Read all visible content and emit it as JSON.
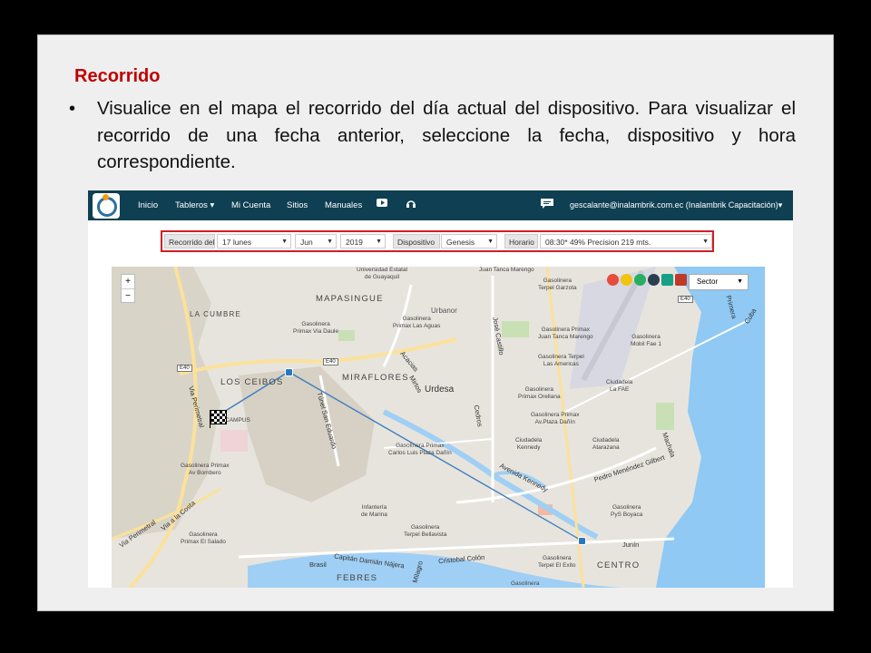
{
  "slide": {
    "title": "Recorrido",
    "bullet": "Visualice en el mapa el recorrido del día actual del dispositivo. Para visualizar el recorrido de una fecha anterior, seleccione la fecha, dispositivo y hora correspondiente."
  },
  "navbar": {
    "items": [
      "Inicio",
      "Tableros ▾",
      "Mi Cuenta",
      "Sitios",
      "Manuales"
    ],
    "icons": [
      "youtube-icon",
      "headset-icon",
      "chat-icon"
    ],
    "user": "gescalante@inalambrik.com.ec (Inalambrik Capacitación)▾"
  },
  "filters": {
    "recorrido_label": "Recorrido del",
    "day": "17 lunes",
    "month": "Jun",
    "year": "2019",
    "dispositivo_label": "Dispositivo",
    "device": "Genesis",
    "horario_label": "Horario",
    "time": "08:30* 49% Precision 219 mts."
  },
  "map": {
    "zoom_in": "+",
    "zoom_out": "−",
    "sector": "Sector",
    "labels": {
      "mapasingue": "MAPASINGUE",
      "la_cumbre": "LA CUMBRE",
      "los_ceibos": "LOS CEIBOS",
      "miraflores": "MIRAFLORES",
      "urdesa": "Urdesa",
      "urbanor": "Urbanor",
      "centro": "CENTRO",
      "febres": "FEBRES",
      "kennedy": "Ciudadela\nKennedy",
      "atarazana": "Ciudadela\nAtarazana",
      "la_fae": "Ciudadela\nLa FAE",
      "infanteria": "Infantería\nde Marina",
      "universidad": "Universidad Estatal\nde Guayaquil",
      "campus": "CAMPUS",
      "pos_1": "Gasolinera\nPrimax Via Daule",
      "pos_2": "Gasolinera\nPrimax Las Aguas",
      "pos_3": "Gasolinera Primax\nJuan Tanca Marengo",
      "pos_4": "Gasolinera\nMobil Fae 1",
      "pos_5": "Gasolinera Terpel\nLas Americas",
      "pos_6": "Gasolinera\nPrimax Orellana",
      "pos_7": "Gasolinera Primax\nAv.Plaza Dañín",
      "pos_8": "Gasolinera Primax\nCarlos Luis Plaza Dañín",
      "pos_9": "Gasolinera Primax\nAv Bombero",
      "pos_10": "Gasolinera\nPrimax El Salado",
      "pos_11": "Gasolinera\nTerpel Bellavista",
      "pos_12": "Gasolinera\nTerpel El Exito",
      "pos_13": "Gasolinera\nPyS Boyaca",
      "pos_14": "Gasolinera\nTerpel Garzota",
      "pos_15": "Juan Tanca Marengo",
      "pos_16": "Gasolinera",
      "road_1": "Via Perimetral",
      "road_2": "Via Perimetral",
      "road_3": "Via a la Costa",
      "road_4": "Túnel San Eduardo",
      "road_5": "Avenida Kennedy",
      "road_6": "Pedro Menéndez Gilbert",
      "road_7": "José Castillo",
      "road_8": "Cedros",
      "road_9": "Acacias",
      "road_10": "Mirtos",
      "road_11": "Capitán Damián Nájera",
      "road_12": "Cristobal Colón",
      "road_13": "Brasil",
      "road_14": "Machala",
      "road_15": "Junín",
      "road_16": "Milagro",
      "road_17": "Primera",
      "road_18": "Cuba",
      "e40_1": "E40",
      "e40_2": "E40",
      "e40_3": "E40"
    }
  }
}
